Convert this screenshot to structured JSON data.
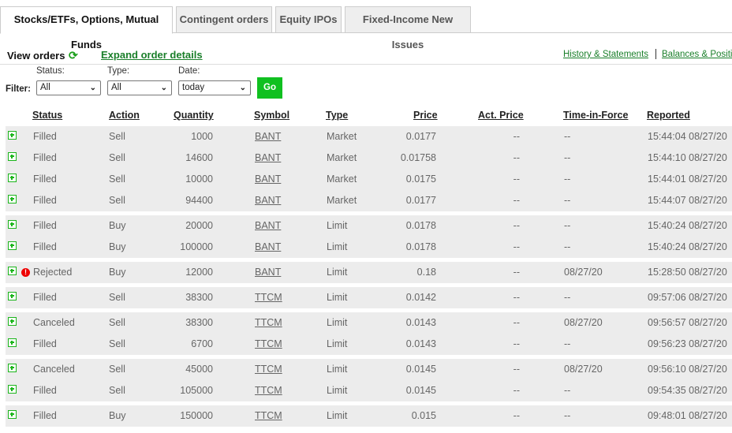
{
  "tabs": [
    "Stocks/ETFs, Options, Mutual Funds",
    "Contingent orders",
    "Equity IPOs",
    "Fixed-Income New Issues"
  ],
  "view_orders": "View orders",
  "expand_link": "Expand order details",
  "right_links": [
    "History & Statements",
    "Balances & Positions"
  ],
  "filter": {
    "label": "Filter:",
    "status_label": "Status:",
    "status_value": "All",
    "type_label": "Type:",
    "type_value": "All",
    "date_label": "Date:",
    "date_value": "today",
    "go": "Go"
  },
  "columns": [
    "Status",
    "Action",
    "Quantity",
    "Symbol",
    "Type",
    "Price",
    "Act. Price",
    "Time-in-Force",
    "Reported"
  ],
  "groups": [
    [
      [
        "Filled",
        "Sell",
        "1000",
        "BANT",
        "Market",
        "0.0177",
        "--",
        "--",
        "15:44:04 08/27/20"
      ],
      [
        "Filled",
        "Sell",
        "14600",
        "BANT",
        "Market",
        "0.01758",
        "--",
        "--",
        "15:44:10 08/27/20"
      ],
      [
        "Filled",
        "Sell",
        "10000",
        "BANT",
        "Market",
        "0.0175",
        "--",
        "--",
        "15:44:01 08/27/20"
      ],
      [
        "Filled",
        "Sell",
        "94400",
        "BANT",
        "Market",
        "0.0177",
        "--",
        "--",
        "15:44:07 08/27/20"
      ]
    ],
    [
      [
        "Filled",
        "Buy",
        "20000",
        "BANT",
        "Limit",
        "0.0178",
        "--",
        "--",
        "15:40:24 08/27/20"
      ],
      [
        "Filled",
        "Buy",
        "100000",
        "BANT",
        "Limit",
        "0.0178",
        "--",
        "--",
        "15:40:24 08/27/20"
      ]
    ],
    [
      [
        "Rejected",
        "Buy",
        "12000",
        "BANT",
        "Limit",
        "0.18",
        "--",
        "08/27/20",
        "15:28:50 08/27/20"
      ]
    ],
    [
      [
        "Filled",
        "Sell",
        "38300",
        "TTCM",
        "Limit",
        "0.0142",
        "--",
        "--",
        "09:57:06 08/27/20"
      ]
    ],
    [
      [
        "Canceled",
        "Sell",
        "38300",
        "TTCM",
        "Limit",
        "0.0143",
        "--",
        "08/27/20",
        "09:56:57 08/27/20"
      ],
      [
        "Filled",
        "Sell",
        "6700",
        "TTCM",
        "Limit",
        "0.0143",
        "--",
        "--",
        "09:56:23 08/27/20"
      ]
    ],
    [
      [
        "Canceled",
        "Sell",
        "45000",
        "TTCM",
        "Limit",
        "0.0145",
        "--",
        "08/27/20",
        "09:56:10 08/27/20"
      ],
      [
        "Filled",
        "Sell",
        "105000",
        "TTCM",
        "Limit",
        "0.0145",
        "--",
        "--",
        "09:54:35 08/27/20"
      ]
    ],
    [
      [
        "Filled",
        "Buy",
        "150000",
        "TTCM",
        "Limit",
        "0.015",
        "--",
        "--",
        "09:48:01 08/27/20"
      ]
    ]
  ]
}
